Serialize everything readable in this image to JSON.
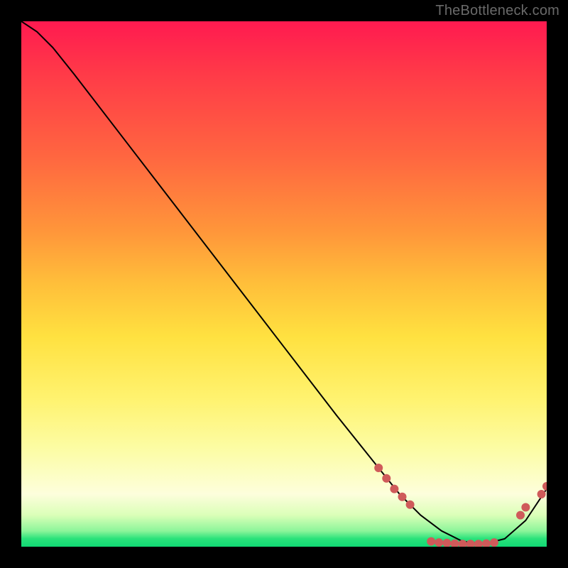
{
  "watermark": "TheBottleneck.com",
  "chart_data": {
    "type": "line",
    "title": "",
    "xlabel": "",
    "ylabel": "",
    "xlim": [
      0,
      100
    ],
    "ylim": [
      0,
      100
    ],
    "series": [
      {
        "name": "curve",
        "x": [
          0,
          3,
          6,
          10,
          20,
          30,
          40,
          50,
          60,
          68,
          72,
          76,
          80,
          84,
          88,
          92,
          96,
          100
        ],
        "values": [
          100,
          98,
          95,
          90,
          77,
          64,
          51,
          38,
          25,
          15,
          10,
          6,
          3,
          1,
          0.5,
          1.5,
          5,
          11
        ]
      }
    ],
    "markers": [
      {
        "x": 68.0,
        "y": 15.0
      },
      {
        "x": 69.5,
        "y": 13.0
      },
      {
        "x": 71.0,
        "y": 11.0
      },
      {
        "x": 72.5,
        "y": 9.5
      },
      {
        "x": 74.0,
        "y": 8.0
      },
      {
        "x": 78.0,
        "y": 1.0
      },
      {
        "x": 79.5,
        "y": 0.8
      },
      {
        "x": 81.0,
        "y": 0.7
      },
      {
        "x": 82.5,
        "y": 0.6
      },
      {
        "x": 84.0,
        "y": 0.5
      },
      {
        "x": 85.5,
        "y": 0.5
      },
      {
        "x": 87.0,
        "y": 0.5
      },
      {
        "x": 88.5,
        "y": 0.6
      },
      {
        "x": 90.0,
        "y": 0.8
      },
      {
        "x": 95.0,
        "y": 6.0
      },
      {
        "x": 96.0,
        "y": 7.5
      },
      {
        "x": 99.0,
        "y": 10.0
      },
      {
        "x": 100.0,
        "y": 11.5
      }
    ],
    "gradient_stops": [
      {
        "pos": 0.0,
        "color": "#ff1a50"
      },
      {
        "pos": 0.5,
        "color": "#ffbf3a"
      },
      {
        "pos": 0.9,
        "color": "#fdfedc"
      },
      {
        "pos": 1.0,
        "color": "#11d874"
      }
    ]
  }
}
